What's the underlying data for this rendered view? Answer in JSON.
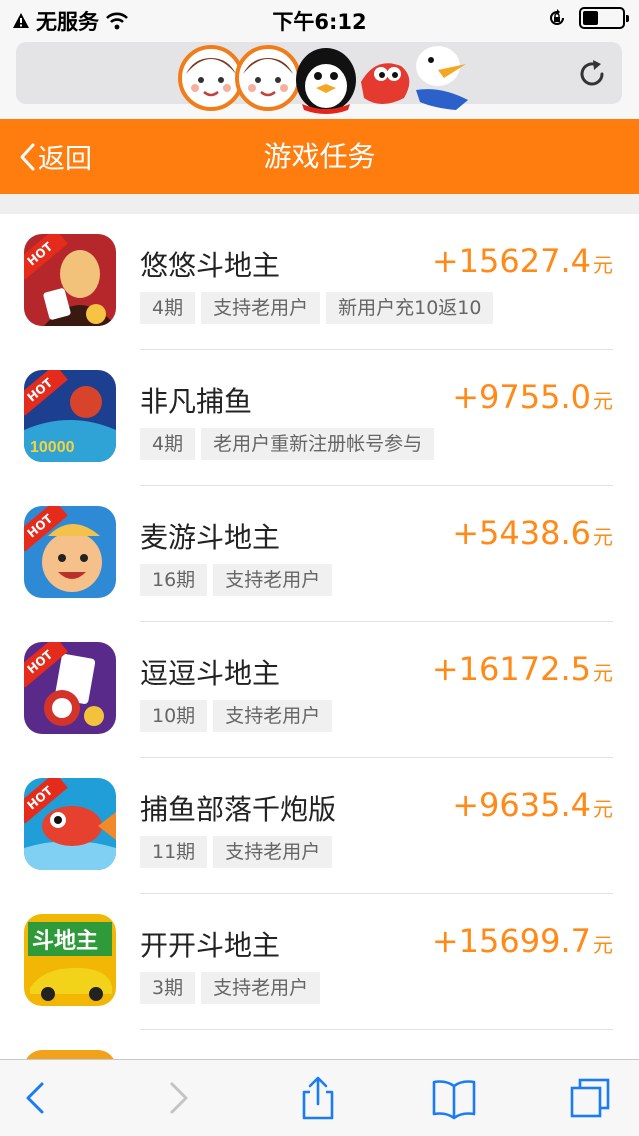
{
  "status_bar": {
    "carrier": "无服务",
    "time": "下午6:12",
    "battery_level": 0.4
  },
  "header": {
    "back_label": "返回",
    "title": "游戏任务"
  },
  "tasks": [
    {
      "name": "悠悠斗地主",
      "reward": "+15627.4",
      "unit": "元",
      "tags": [
        "4期",
        "支持老用户",
        "新用户充10返10"
      ],
      "hot": true,
      "icon": {
        "name": "youyou-doudizhu-icon",
        "colors": [
          "#b5272b",
          "#f3c27a"
        ]
      }
    },
    {
      "name": "非凡捕鱼",
      "reward": "+9755.0",
      "unit": "元",
      "tags": [
        "4期",
        "老用户重新注册帐号参与"
      ],
      "hot": true,
      "icon": {
        "name": "feifan-buyu-icon",
        "colors": [
          "#1d3f8f",
          "#2fa3d6"
        ]
      }
    },
    {
      "name": "麦游斗地主",
      "reward": "+5438.6",
      "unit": "元",
      "tags": [
        "16期",
        "支持老用户"
      ],
      "hot": true,
      "icon": {
        "name": "maiyou-doudizhu-icon",
        "colors": [
          "#2f8ad6",
          "#f4c24a"
        ]
      }
    },
    {
      "name": "逗逗斗地主",
      "reward": "+16172.5",
      "unit": "元",
      "tags": [
        "10期",
        "支持老用户"
      ],
      "hot": true,
      "icon": {
        "name": "doudou-doudizhu-icon",
        "colors": [
          "#5a2a8a",
          "#f2c23a"
        ]
      }
    },
    {
      "name": "捕鱼部落千炮版",
      "reward": "+9635.4",
      "unit": "元",
      "tags": [
        "11期",
        "支持老用户"
      ],
      "hot": true,
      "icon": {
        "name": "buyu-buluo-icon",
        "colors": [
          "#1f9ed8",
          "#e6402f"
        ]
      }
    },
    {
      "name": "开开斗地主",
      "reward": "+15699.7",
      "unit": "元",
      "tags": [
        "3期",
        "支持老用户"
      ],
      "hot": false,
      "icon": {
        "name": "kaikai-doudizhu-icon",
        "colors": [
          "#f2b705",
          "#d13a1a"
        ]
      }
    }
  ],
  "icon_badge_text": "HOT",
  "colors": {
    "accent": "#ff7d0f",
    "reward": "#ff8a17",
    "hot_badge": "#e52b1c",
    "toolbar_icon": "#1a7cf5"
  }
}
